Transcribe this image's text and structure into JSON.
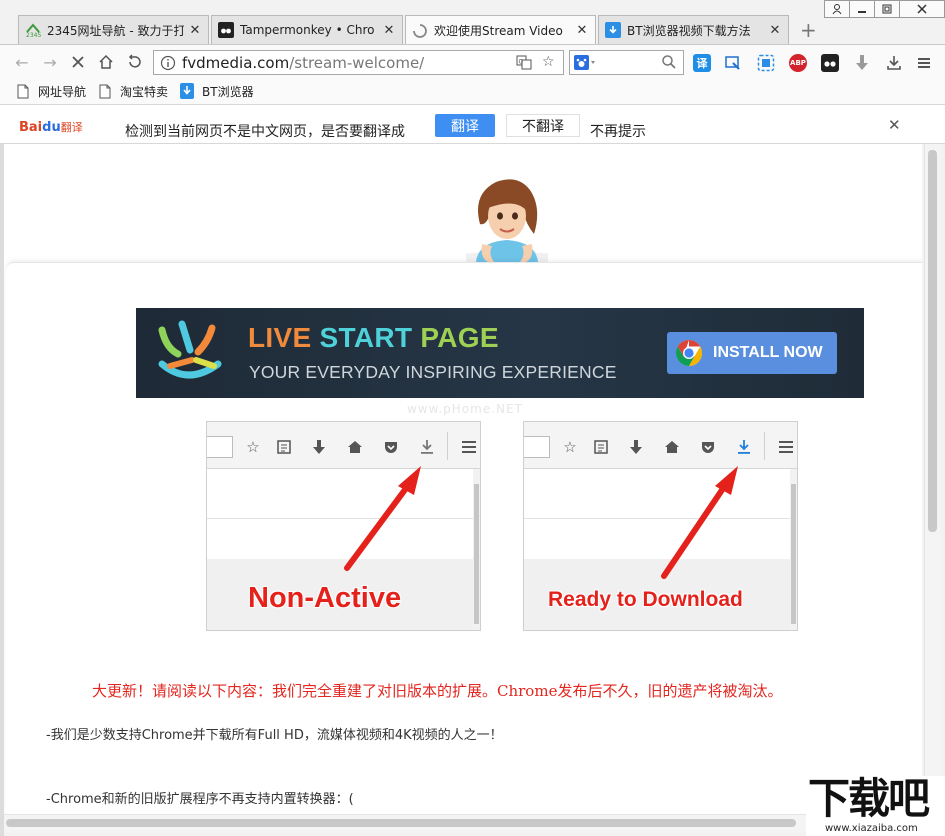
{
  "window": {
    "controls": [
      "user-icon",
      "minimize-icon",
      "restore-icon",
      "close-icon"
    ]
  },
  "tabs": [
    {
      "title": "2345网址导航 - 致力于打",
      "icon": "2345-icon"
    },
    {
      "title": "Tampermonkey • Chro",
      "icon": "tampermonkey-icon"
    },
    {
      "title": "欢迎使用Stream Video",
      "icon": "loading-icon",
      "active": true
    },
    {
      "title": "BT浏览器视频下载方法",
      "icon": "download-icon"
    }
  ],
  "toolbar": {
    "url_host": "fvdmedia.com",
    "url_path": "/stream-welcome/"
  },
  "bookmarks": [
    {
      "label": "网址导航",
      "icon": "page-icon"
    },
    {
      "label": "淘宝特卖",
      "icon": "page-icon"
    },
    {
      "label": "BT浏览器",
      "icon": "download-icon"
    }
  ],
  "translate_bar": {
    "logo": "Bai",
    "logo_paw": "du",
    "logo_fy": "翻译",
    "message": "检测到当前网页不是中文网页，是否要翻译成",
    "translate_label": "翻译",
    "no_translate_label": "不翻译",
    "never_label": "不再提示"
  },
  "banner": {
    "title_1": "LIVE",
    "title_2": "START",
    "title_3": "PAGE",
    "subtitle": "YOUR EVERYDAY INSPIRING EXPERIENCE",
    "install_label": "INSTALL NOW"
  },
  "watermark": "www.pHome.NET",
  "screens": [
    {
      "caption": "Non-Active",
      "download_icon_color": "#777777"
    },
    {
      "caption": "Ready to Download",
      "download_icon_color": "#1e7fdc"
    }
  ],
  "headline": "大更新！请阅读以下内容：我们完全重建了对旧版本的扩展。Chrome发布后不久，旧的遗产将被淘汰。",
  "paragraphs": [
    "-我们是少数支持Chrome并下载所有Full HD，流媒体视频和4K视频的人之一！",
    "-Chrome和新的旧版扩展程序不再支持内置转换器：("
  ],
  "corner_watermark": {
    "big": "下载吧",
    "small": "www.xiazaiba.com"
  },
  "colors": {
    "accent_blue": "#3f8ef2",
    "headline_red": "#e3261f",
    "caption_red": "#e5211c",
    "banner_bg": "#1e2a36"
  }
}
